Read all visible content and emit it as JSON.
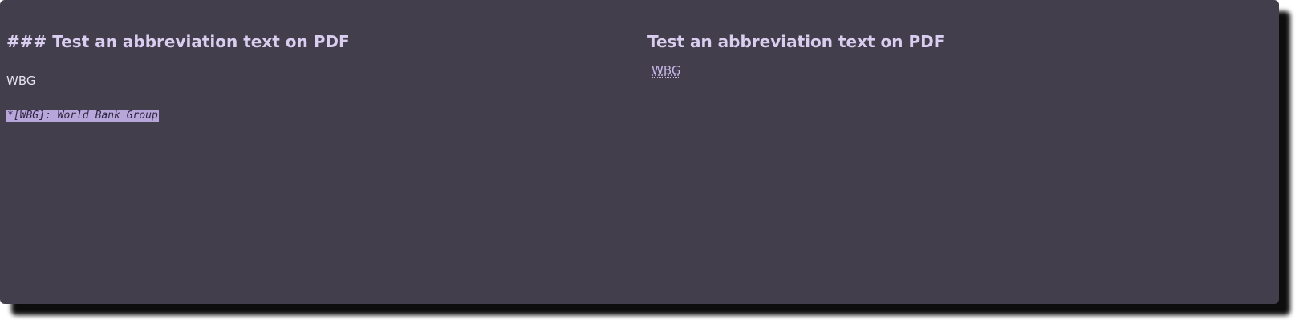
{
  "editor": {
    "heading": "### Test an abbreviation text on PDF",
    "line": "WBG",
    "abbr_definition": "*[WBG]: World Bank Group"
  },
  "preview": {
    "heading": "Test an abbreviation text on PDF",
    "abbr_text": "WBG",
    "abbr_title": "World Bank Group"
  },
  "colors": {
    "background": "#433e4b",
    "heading": "#d9cdf0",
    "selection": "#b7a6d9",
    "divider": "#7a6aa8"
  }
}
